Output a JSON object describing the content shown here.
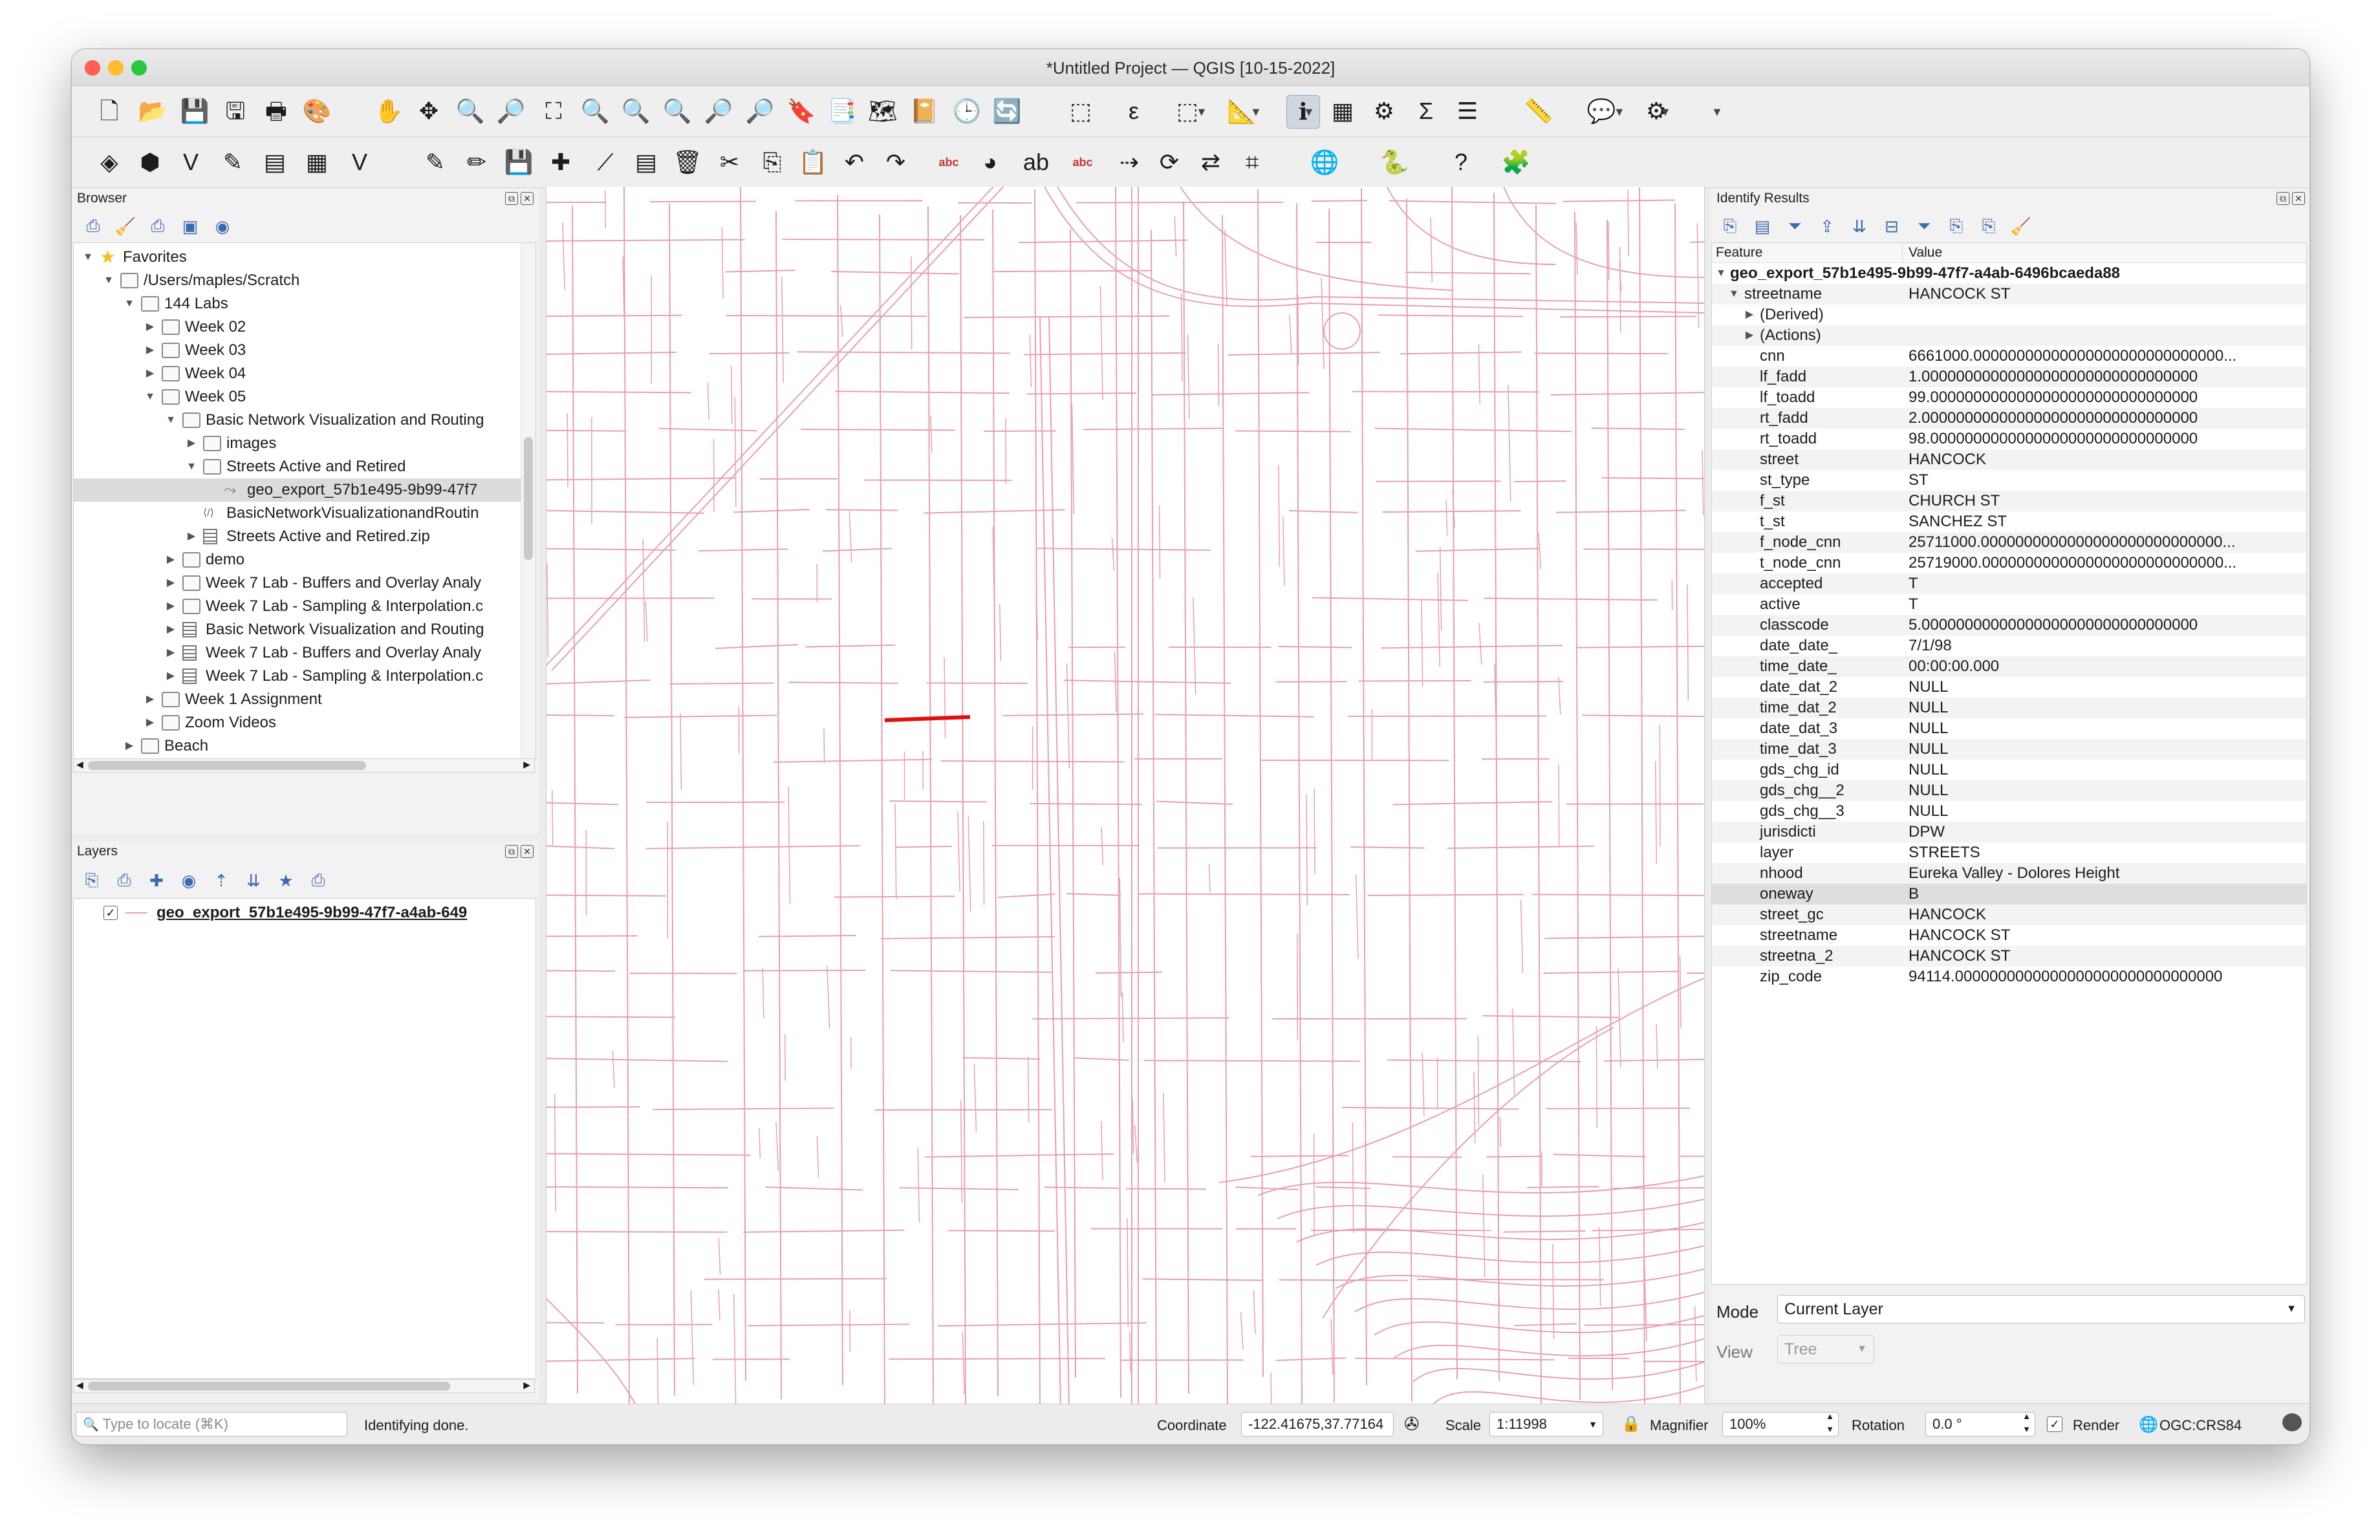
{
  "window": {
    "title": "*Untitled Project — QGIS [10-15-2022]",
    "traffic_lights": {
      "close": "#ff5f57",
      "minimize": "#febc2e",
      "zoom": "#28c840"
    }
  },
  "toolbar1": [
    "new-project-icon",
    "open-project-icon",
    "save-project-icon",
    "save-as-icon",
    "print-layout-icon",
    "style-manager-icon",
    "pan-icon",
    "pan-to-selection-icon",
    "zoom-in-icon",
    "zoom-out-icon",
    "zoom-full-icon",
    "zoom-to-selection-icon",
    "zoom-to-layer-icon",
    "zoom-native-icon",
    "zoom-last-icon",
    "zoom-next-icon",
    "new-bookmark-icon",
    "show-bookmarks-icon",
    "new-map-view-icon",
    "map-tips-icon",
    "temporal-controller-icon",
    "refresh-icon",
    "select-features-icon",
    "select-by-expression-icon",
    "deselect-icon",
    "measure-icon",
    "identify-icon",
    "attribute-table-icon",
    "processing-toolbox-icon",
    "statistical-summary-icon",
    "open-table-icon",
    "measure-line-icon",
    "annotation-icon",
    "locator-icon"
  ],
  "toolbar2": [
    "data-source-manager-icon",
    "new-geopackage-icon",
    "new-shapefile-icon",
    "digitize-icon",
    "new-virtual-layer-icon",
    "new-raster-icon",
    "new-vector-icon",
    "edit-icon",
    "toggle-editing-icon",
    "save-edits-icon",
    "add-feature-icon",
    "vertex-tool-icon",
    "modify-attributes-icon",
    "delete-selected-icon",
    "cut-icon",
    "copy-icon",
    "paste-icon",
    "undo-icon",
    "redo-icon",
    "label-icon",
    "diagram-icon",
    "pin-label-icon",
    "show-label-icon",
    "move-label-icon",
    "rotate-label-icon",
    "change-label-icon",
    "label-toolbar-icon",
    "georeferencer-icon",
    "python-icon",
    "help-icon",
    "plugin-manager-icon"
  ],
  "browser": {
    "title": "Browser",
    "tools": [
      "add-selected-icon",
      "refresh-icon",
      "filter-icon",
      "collapse-all-icon",
      "properties-icon"
    ],
    "items": [
      {
        "label": "Favorites",
        "level": 0,
        "type": "star",
        "expanded": true
      },
      {
        "label": "/Users/maples/Scratch",
        "level": 1,
        "type": "folder",
        "expanded": true
      },
      {
        "label": "144 Labs",
        "level": 2,
        "type": "folder",
        "expanded": true
      },
      {
        "label": "Week 02",
        "level": 3,
        "type": "folder",
        "expanded": false
      },
      {
        "label": "Week 03",
        "level": 3,
        "type": "folder",
        "expanded": false
      },
      {
        "label": "Week 04",
        "level": 3,
        "type": "folder",
        "expanded": false
      },
      {
        "label": "Week 05",
        "level": 3,
        "type": "folder",
        "expanded": true
      },
      {
        "label": "Basic Network Visualization and Routing",
        "level": 4,
        "type": "folder",
        "expanded": true
      },
      {
        "label": "images",
        "level": 5,
        "type": "folder",
        "expanded": false
      },
      {
        "label": "Streets Active and Retired",
        "level": 5,
        "type": "folder",
        "expanded": true
      },
      {
        "label": "geo_export_57b1e495-9b99-47f7",
        "level": 6,
        "type": "layer",
        "expanded": null,
        "selected": true
      },
      {
        "label": "BasicNetworkVisualizationandRoutin",
        "level": 5,
        "type": "qgz",
        "expanded": null
      },
      {
        "label": "Streets Active and Retired.zip",
        "level": 5,
        "type": "zip",
        "expanded": false
      },
      {
        "label": "demo",
        "level": 4,
        "type": "folder",
        "expanded": false
      },
      {
        "label": "Week 7 Lab - Buffers and Overlay Analy",
        "level": 4,
        "type": "folder",
        "expanded": false
      },
      {
        "label": "Week 7 Lab - Sampling & Interpolation.c",
        "level": 4,
        "type": "folder",
        "expanded": false
      },
      {
        "label": "Basic Network Visualization and Routing",
        "level": 4,
        "type": "zip",
        "expanded": false
      },
      {
        "label": "Week 7 Lab - Buffers and Overlay Analy",
        "level": 4,
        "type": "zip",
        "expanded": false
      },
      {
        "label": "Week 7 Lab - Sampling & Interpolation.c",
        "level": 4,
        "type": "zip",
        "expanded": false
      },
      {
        "label": "Week 1 Assignment",
        "level": 3,
        "type": "folder",
        "expanded": false
      },
      {
        "label": "Zoom Videos",
        "level": 3,
        "type": "folder",
        "expanded": false
      },
      {
        "label": "Beach",
        "level": 2,
        "type": "folder",
        "expanded": false
      }
    ]
  },
  "layers": {
    "title": "Layers",
    "tools": [
      "style-panel-icon",
      "add-group-icon",
      "visibility-icon",
      "filter-legend-icon",
      "expression-filter-icon",
      "expand-all-icon",
      "collapse-all-icon",
      "remove-layer-icon"
    ],
    "items": [
      {
        "label": "geo_export_57b1e495-9b99-47f7-a4ab-649",
        "checked": true
      }
    ]
  },
  "identify": {
    "title": "Identify Results",
    "tools": [
      "expand-tree-icon",
      "expand-all-icon",
      "collapse-all-icon",
      "expand-new-icon",
      "clear-results-icon",
      "copy-feature-icon",
      "print-icon",
      "select-mode-icon",
      "settings-icon",
      "help-icon"
    ],
    "col_feature": "Feature",
    "col_value": "Value",
    "layer": "geo_export_57b1e495-9b99-47f7-a4ab-6496bcaeda88",
    "feature": {
      "key": "streetname",
      "value": "HANCOCK ST"
    },
    "groups": [
      "(Derived)",
      "(Actions)"
    ],
    "attributes": [
      {
        "k": "cnn",
        "v": "6661000.00000000000000000000000000000..."
      },
      {
        "k": "lf_fadd",
        "v": "1.00000000000000000000000000000000"
      },
      {
        "k": "lf_toadd",
        "v": "99.0000000000000000000000000000000"
      },
      {
        "k": "rt_fadd",
        "v": "2.00000000000000000000000000000000"
      },
      {
        "k": "rt_toadd",
        "v": "98.0000000000000000000000000000000"
      },
      {
        "k": "street",
        "v": "HANCOCK"
      },
      {
        "k": "st_type",
        "v": "ST"
      },
      {
        "k": "f_st",
        "v": "CHURCH ST"
      },
      {
        "k": "t_st",
        "v": "SANCHEZ ST"
      },
      {
        "k": "f_node_cnn",
        "v": "25711000.0000000000000000000000000000..."
      },
      {
        "k": "t_node_cnn",
        "v": "25719000.0000000000000000000000000000..."
      },
      {
        "k": "accepted",
        "v": "T"
      },
      {
        "k": "active",
        "v": "T"
      },
      {
        "k": "classcode",
        "v": "5.00000000000000000000000000000000"
      },
      {
        "k": "date_date_",
        "v": "7/1/98"
      },
      {
        "k": "time_date_",
        "v": "00:00:00.000"
      },
      {
        "k": "date_dat_2",
        "v": "NULL"
      },
      {
        "k": "time_dat_2",
        "v": "NULL"
      },
      {
        "k": "date_dat_3",
        "v": "NULL"
      },
      {
        "k": "time_dat_3",
        "v": "NULL"
      },
      {
        "k": "gds_chg_id",
        "v": "NULL"
      },
      {
        "k": "gds_chg__2",
        "v": "NULL"
      },
      {
        "k": "gds_chg__3",
        "v": "NULL"
      },
      {
        "k": "jurisdicti",
        "v": "DPW"
      },
      {
        "k": "layer",
        "v": "STREETS"
      },
      {
        "k": "nhood",
        "v": "Eureka Valley - Dolores Height"
      },
      {
        "k": "oneway",
        "v": "B"
      },
      {
        "k": "street_gc",
        "v": "HANCOCK"
      },
      {
        "k": "streetname",
        "v": "HANCOCK ST"
      },
      {
        "k": "streetna_2",
        "v": "HANCOCK ST"
      },
      {
        "k": "zip_code",
        "v": "94114.0000000000000000000000000000000"
      }
    ],
    "mode_label": "Mode",
    "mode_value": "Current Layer",
    "view_label": "View",
    "view_value": "Tree"
  },
  "map": {
    "street_color": "#e8a0ae",
    "highlight_color": "#e01010"
  },
  "status": {
    "locator_placeholder": "Type to locate (⌘K)",
    "message": "Identifying done.",
    "coordinate_label": "Coordinate",
    "coordinate_value": "-122.41675,37.77164",
    "scale_label": "Scale",
    "scale_value": "1:11998",
    "magnifier_label": "Magnifier",
    "magnifier_value": "100%",
    "rotation_label": "Rotation",
    "rotation_value": "0.0 °",
    "render_label": "Render",
    "crs": "OGC:CRS84"
  }
}
